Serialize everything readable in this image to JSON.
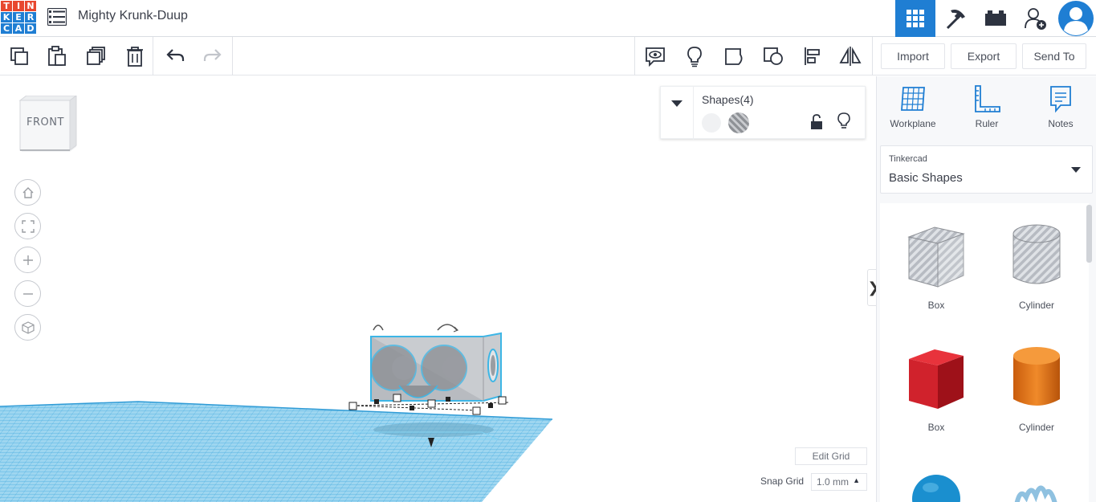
{
  "app": {
    "logo_letters": [
      "T",
      "I",
      "N",
      "K",
      "E",
      "R",
      "C",
      "A",
      "D"
    ],
    "logo_colors": [
      "#e8482f",
      "#e8482f",
      "#e8482f",
      "#1f7ed3",
      "#1f7ed3",
      "#1f7ed3",
      "#1f7ed3",
      "#1f7ed3",
      "#1f7ed3"
    ],
    "document_title": "Mighty Krunk-Duup"
  },
  "header_icons": [
    "grid-view-icon",
    "pickaxe-icon",
    "bricks-icon",
    "add-user-icon",
    "user-avatar-icon"
  ],
  "toolbar": {
    "icons": [
      "copy-icon",
      "paste-icon",
      "duplicate-icon",
      "delete-icon",
      "undo-icon",
      "redo-icon",
      "note-icon",
      "bulb-icon",
      "group-icon",
      "ungroup-icon",
      "align-icon",
      "mirror-icon"
    ],
    "import_label": "Import",
    "export_label": "Export",
    "send_to_label": "Send To"
  },
  "viewcube": {
    "face_label": "FRONT"
  },
  "nav_controls": [
    "home-icon",
    "fit-icon",
    "zoom-in-icon",
    "zoom-out-icon",
    "view-cube-icon"
  ],
  "shapes_panel": {
    "title": "Shapes(4)"
  },
  "grid_controls": {
    "edit_grid_label": "Edit Grid",
    "snap_grid_label": "Snap Grid",
    "snap_grid_value": "1.0 mm"
  },
  "right_panel": {
    "tools": [
      {
        "label": "Workplane",
        "icon": "workplane-icon"
      },
      {
        "label": "Ruler",
        "icon": "ruler-icon"
      },
      {
        "label": "Notes",
        "icon": "notes-icon"
      }
    ],
    "library_small": "Tinkercad",
    "library_main": "Basic Shapes",
    "shapes": [
      {
        "label": "Box",
        "kind": "hole-box"
      },
      {
        "label": "Cylinder",
        "kind": "hole-cylinder"
      },
      {
        "label": "Box",
        "kind": "solid-box",
        "color": "#d0222c"
      },
      {
        "label": "Cylinder",
        "kind": "solid-cylinder",
        "color": "#e0761b"
      }
    ]
  },
  "colors": {
    "accent": "#1f7ed3",
    "grid": "#4ab0e0"
  }
}
